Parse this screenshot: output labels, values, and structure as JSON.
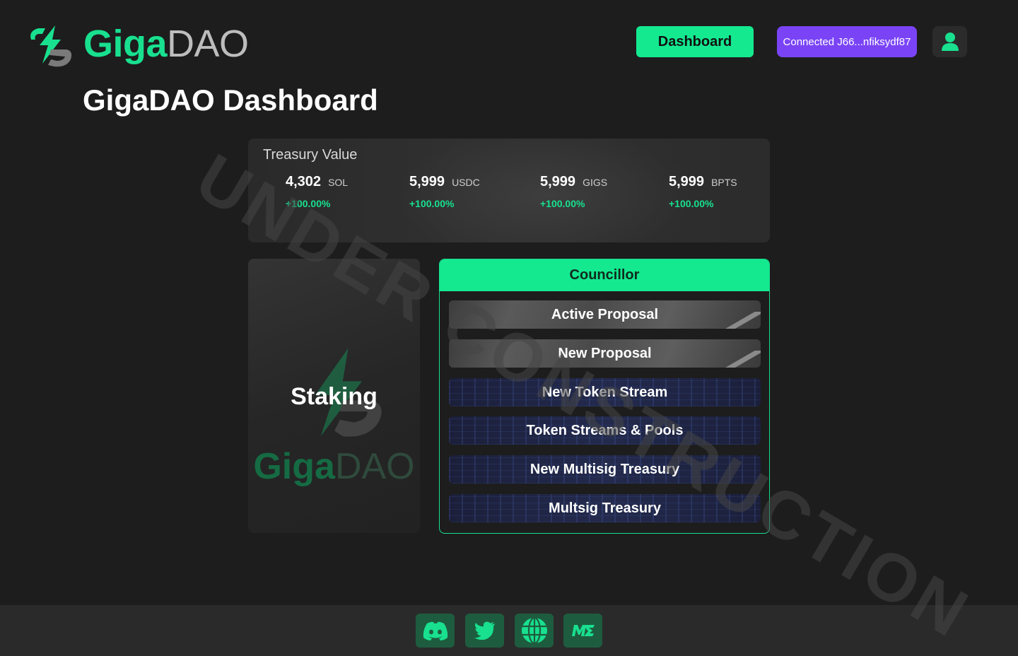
{
  "brand": {
    "name_part1": "Giga",
    "name_part2": "DAO"
  },
  "header": {
    "dashboard_label": "Dashboard",
    "wallet_label": "Connected J66...nfiksydf87"
  },
  "page": {
    "title": "GigaDAO Dashboard"
  },
  "treasury": {
    "label": "Treasury Value",
    "tokens": [
      {
        "amount": "4,302",
        "symbol": "SOL",
        "change": "+100.00%"
      },
      {
        "amount": "5,999",
        "symbol": "USDC",
        "change": "+100.00%"
      },
      {
        "amount": "5,999",
        "symbol": "GIGS",
        "change": "+100.00%"
      },
      {
        "amount": "5,999",
        "symbol": "BPTS",
        "change": "+100.00%"
      }
    ]
  },
  "staking": {
    "title": "Staking",
    "brand_part1": "Giga",
    "brand_part2": "DAO"
  },
  "councillor": {
    "title": "Councillor",
    "buttons": [
      "Active Proposal",
      "New Proposal",
      "New Token Stream",
      "Token Streams & Pools",
      "New Multisig Treasury",
      "Multsig Treasury"
    ]
  },
  "watermark": "UNDER CONSTRUCTION",
  "footer": {
    "icons": [
      "discord-icon",
      "twitter-icon",
      "globe-icon",
      "magic-eden-icon"
    ]
  },
  "colors": {
    "accent": "#14e990",
    "wallet": "#7a44f6",
    "background": "#1d1d1d",
    "footer": "#2a2a2a"
  }
}
